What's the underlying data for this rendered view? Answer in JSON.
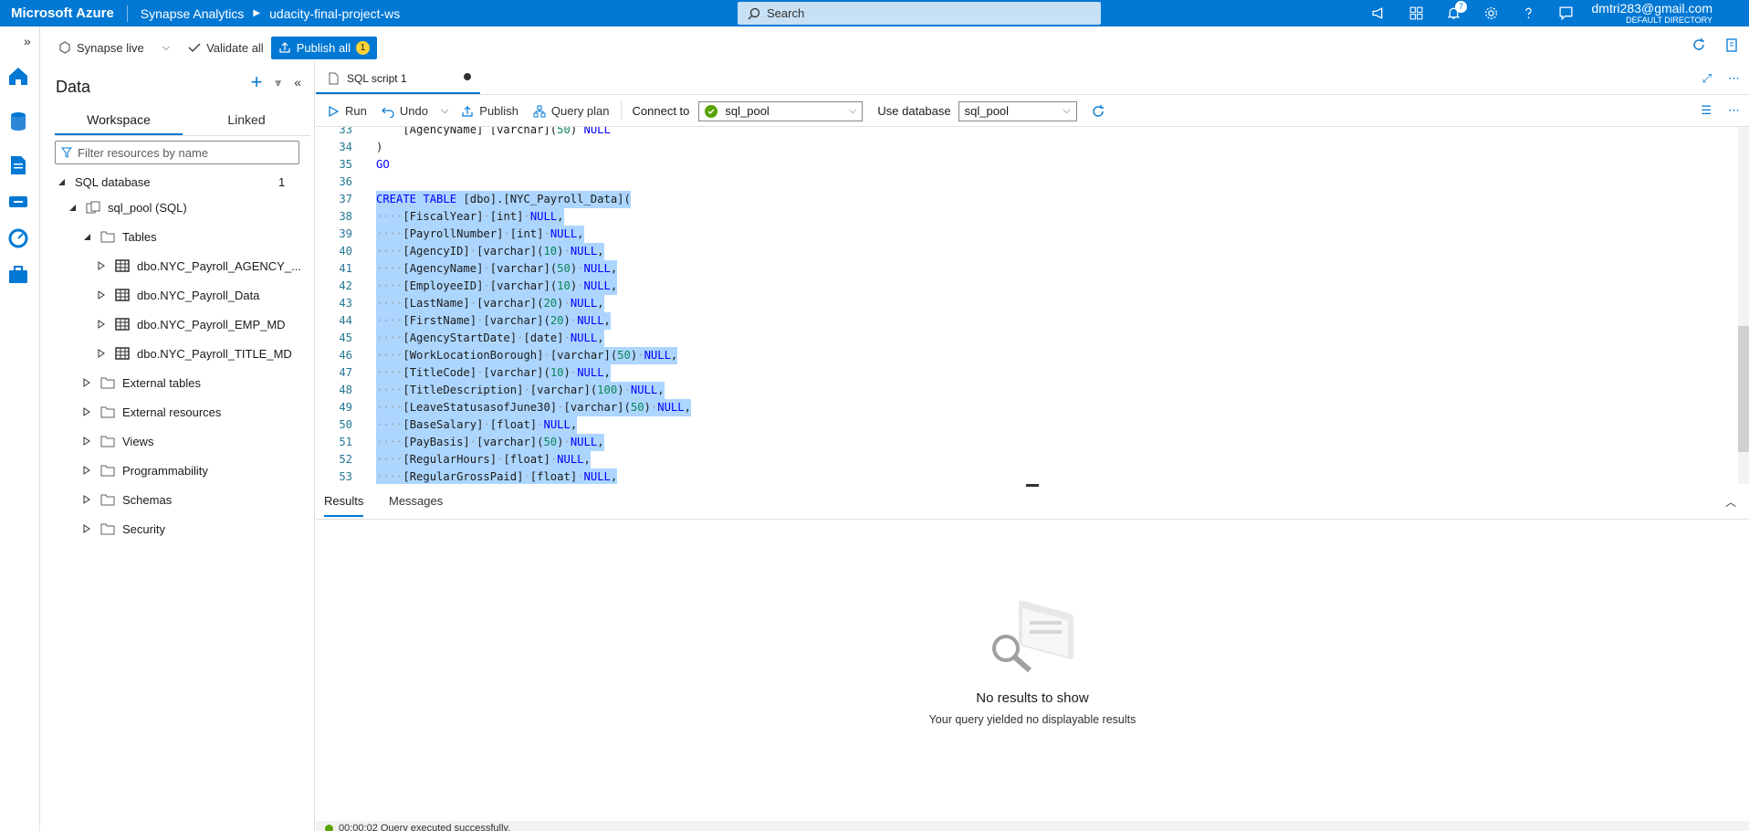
{
  "topbar": {
    "brand": "Microsoft Azure",
    "service": "Synapse Analytics",
    "workspace": "udacity-final-project-ws",
    "search_placeholder": "Search",
    "notifications_count": "7",
    "user_email": "dmtri283@gmail.com",
    "user_directory": "DEFAULT DIRECTORY"
  },
  "toolbar": {
    "synapse_live": "Synapse live",
    "validate_all": "Validate all",
    "publish_all": "Publish all",
    "publish_count": "1"
  },
  "data_panel": {
    "title": "Data",
    "tabs": [
      "Workspace",
      "Linked"
    ],
    "filter_placeholder": "Filter resources by name",
    "tree": {
      "sql_database": "SQL database",
      "sql_database_count": "1",
      "pool": "sql_pool (SQL)",
      "tables": "Tables",
      "table_items": [
        "dbo.NYC_Payroll_AGENCY_...",
        "dbo.NYC_Payroll_Data",
        "dbo.NYC_Payroll_EMP_MD",
        "dbo.NYC_Payroll_TITLE_MD"
      ],
      "folders": [
        "External tables",
        "External resources",
        "Views",
        "Programmability",
        "Schemas",
        "Security"
      ]
    }
  },
  "editor": {
    "tab_title": "SQL script 1",
    "run": "Run",
    "undo": "Undo",
    "publish": "Publish",
    "query_plan": "Query plan",
    "connect_to_label": "Connect to",
    "connect_to_value": "sql_pool",
    "use_database_label": "Use database",
    "use_database_value": "sql_pool"
  },
  "code_lines": [
    {
      "n": "33",
      "text": "    [AgencyName] [varchar](50) NULL"
    },
    {
      "n": "34",
      "text": ")"
    },
    {
      "n": "35",
      "text": "GO"
    },
    {
      "n": "36",
      "text": ""
    },
    {
      "n": "37",
      "text": "CREATE TABLE [dbo].[NYC_Payroll_Data]("
    },
    {
      "n": "38",
      "text": "····[FiscalYear]·[int]·NULL,"
    },
    {
      "n": "39",
      "text": "····[PayrollNumber]·[int]·NULL,"
    },
    {
      "n": "40",
      "text": "····[AgencyID]·[varchar](10)·NULL,"
    },
    {
      "n": "41",
      "text": "····[AgencyName]·[varchar](50)·NULL,"
    },
    {
      "n": "42",
      "text": "····[EmployeeID]·[varchar](10)·NULL,"
    },
    {
      "n": "43",
      "text": "····[LastName]·[varchar](20)·NULL,"
    },
    {
      "n": "44",
      "text": "····[FirstName]·[varchar](20)·NULL,"
    },
    {
      "n": "45",
      "text": "····[AgencyStartDate]·[date]·NULL,"
    },
    {
      "n": "46",
      "text": "····[WorkLocationBorough]·[varchar](50)·NULL,"
    },
    {
      "n": "47",
      "text": "····[TitleCode]·[varchar](10)·NULL,"
    },
    {
      "n": "48",
      "text": "····[TitleDescription]·[varchar](100)·NULL,"
    },
    {
      "n": "49",
      "text": "····[LeaveStatusasofJune30]·[varchar](50)·NULL,"
    },
    {
      "n": "50",
      "text": "····[BaseSalary]·[float]·NULL,"
    },
    {
      "n": "51",
      "text": "····[PayBasis]·[varchar](50)·NULL,"
    },
    {
      "n": "52",
      "text": "····[RegularHours]·[float]·NULL,"
    },
    {
      "n": "53",
      "text": "····[RegularGrossPaid]·[float]·NULL,"
    }
  ],
  "results": {
    "tabs": [
      "Results",
      "Messages"
    ],
    "empty_title": "No results to show",
    "empty_subtitle": "Your query yielded no displayable results",
    "status": "00:00:02 Query executed successfully."
  },
  "colors": {
    "accent": "#0078d4",
    "selection": "#add6ff",
    "success": "#57a300"
  }
}
